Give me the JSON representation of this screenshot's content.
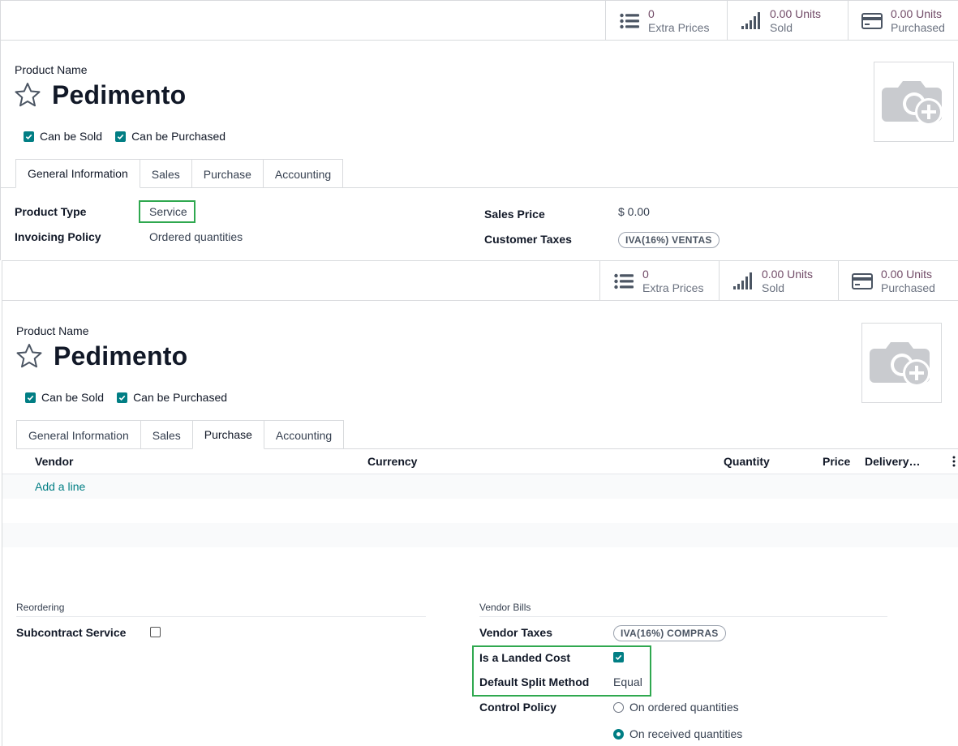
{
  "stats": {
    "extra_prices_value": "0",
    "extra_prices_label": "Extra Prices",
    "sold_value": "0.00 Units",
    "sold_label": "Sold",
    "purchased_value": "0.00 Units",
    "purchased_label": "Purchased"
  },
  "product": {
    "name_label": "Product Name",
    "name": "Pedimento",
    "can_be_sold_label": "Can be Sold",
    "can_be_purchased_label": "Can be Purchased",
    "can_be_sold": true,
    "can_be_purchased": true
  },
  "tabs": [
    "General Information",
    "Sales",
    "Purchase",
    "Accounting"
  ],
  "general": {
    "product_type_label": "Product Type",
    "product_type_value": "Service",
    "invoicing_policy_label": "Invoicing Policy",
    "invoicing_policy_value": "Ordered quantities",
    "sales_price_label": "Sales Price",
    "sales_price_value": "$ 0.00",
    "customer_taxes_label": "Customer Taxes",
    "customer_taxes_value": "IVA(16%) VENTAS"
  },
  "purchase": {
    "columns": [
      "Vendor",
      "Currency",
      "Quantity",
      "Price",
      "Delivery…"
    ],
    "add_line": "Add a line",
    "reordering_header": "Reordering",
    "subcontract_label": "Subcontract Service",
    "subcontract_checked": false,
    "vendor_bills_header": "Vendor Bills",
    "vendor_taxes_label": "Vendor Taxes",
    "vendor_taxes_value": "IVA(16%) COMPRAS",
    "landed_cost_label": "Is a Landed Cost",
    "landed_cost_checked": true,
    "split_method_label": "Default Split Method",
    "split_method_value": "Equal",
    "control_policy_label": "Control Policy",
    "control_policy_options": [
      "On ordered quantities",
      "On received quantities"
    ],
    "control_policy_selected": "On received quantities"
  },
  "colors": {
    "accent": "#017e84",
    "brand": "#714b67",
    "highlight": "#2fa84f"
  }
}
